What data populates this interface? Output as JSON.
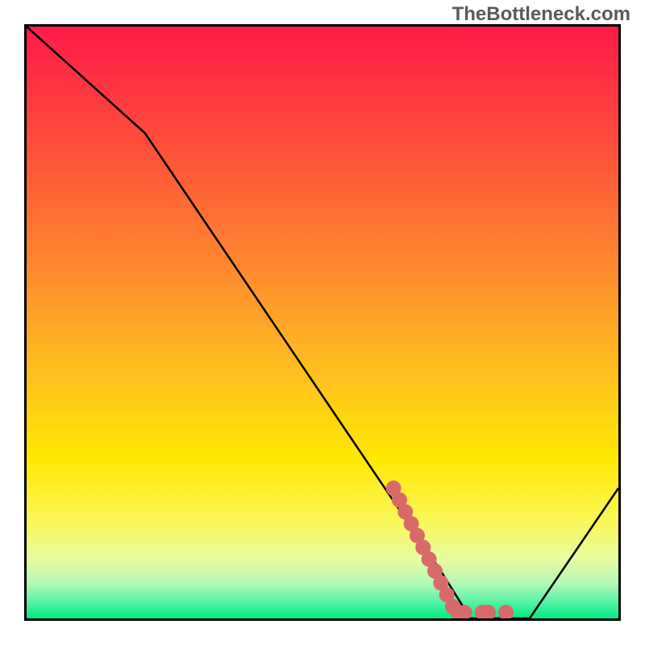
{
  "watermark": "TheBottleneck.com",
  "chart_data": {
    "type": "line",
    "title": "",
    "xlabel": "",
    "ylabel": "",
    "xlim": [
      0,
      100
    ],
    "ylim": [
      0,
      100
    ],
    "background_gradient": {
      "stops": [
        {
          "pos": 0.0,
          "color": "#ff1a48"
        },
        {
          "pos": 0.2,
          "color": "#ff4e3a"
        },
        {
          "pos": 0.42,
          "color": "#ff8d2e"
        },
        {
          "pos": 0.6,
          "color": "#ffc41c"
        },
        {
          "pos": 0.73,
          "color": "#ffe800"
        },
        {
          "pos": 0.84,
          "color": "#faf85e"
        },
        {
          "pos": 0.9,
          "color": "#e8fca0"
        },
        {
          "pos": 0.94,
          "color": "#b4f8b6"
        },
        {
          "pos": 0.97,
          "color": "#5ef3a6"
        },
        {
          "pos": 1.0,
          "color": "#00ec84"
        }
      ]
    },
    "series": [
      {
        "name": "bottleneck-curve",
        "stroke": "#000000",
        "x": [
          0,
          20,
          70,
          75,
          85,
          100
        ],
        "values": [
          100,
          82,
          8,
          0,
          0,
          22
        ]
      }
    ],
    "scatter_accent": {
      "name": "accent-dots",
      "color": "#d86b6a",
      "points": [
        {
          "x": 62,
          "y": 22
        },
        {
          "x": 63,
          "y": 20
        },
        {
          "x": 64,
          "y": 18
        },
        {
          "x": 65,
          "y": 16
        },
        {
          "x": 66,
          "y": 14
        },
        {
          "x": 67,
          "y": 12
        },
        {
          "x": 68,
          "y": 10
        },
        {
          "x": 69,
          "y": 8
        },
        {
          "x": 70,
          "y": 6
        },
        {
          "x": 71,
          "y": 4
        },
        {
          "x": 72,
          "y": 2
        },
        {
          "x": 73,
          "y": 1
        },
        {
          "x": 74,
          "y": 1
        },
        {
          "x": 77,
          "y": 1
        },
        {
          "x": 78,
          "y": 1
        },
        {
          "x": 81,
          "y": 1
        }
      ]
    }
  }
}
